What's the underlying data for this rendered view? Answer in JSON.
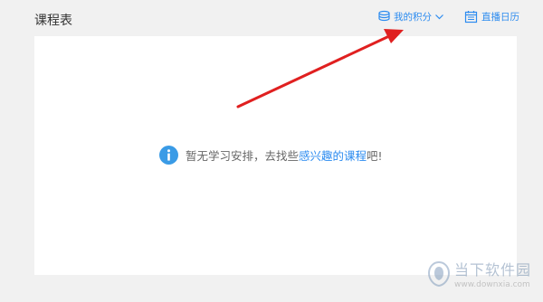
{
  "header": {
    "title": "课程表",
    "points_label": "我的积分",
    "calendar_label": "直播日历"
  },
  "empty_state": {
    "prefix": "暂无学习安排，去找些",
    "link": "感兴趣的课程",
    "suffix": "吧!"
  },
  "watermark": {
    "title": "当下软件园",
    "url": "www.downxia.com"
  },
  "icons": {
    "points": "coins-stack-icon",
    "points_toggle": "chevron-down-icon",
    "calendar": "calendar-icon",
    "info": "info-icon"
  },
  "colors": {
    "accent": "#2d8cf0",
    "info": "#3a9be6",
    "annotation_arrow": "#e02020",
    "background": "#f1f1f1"
  }
}
